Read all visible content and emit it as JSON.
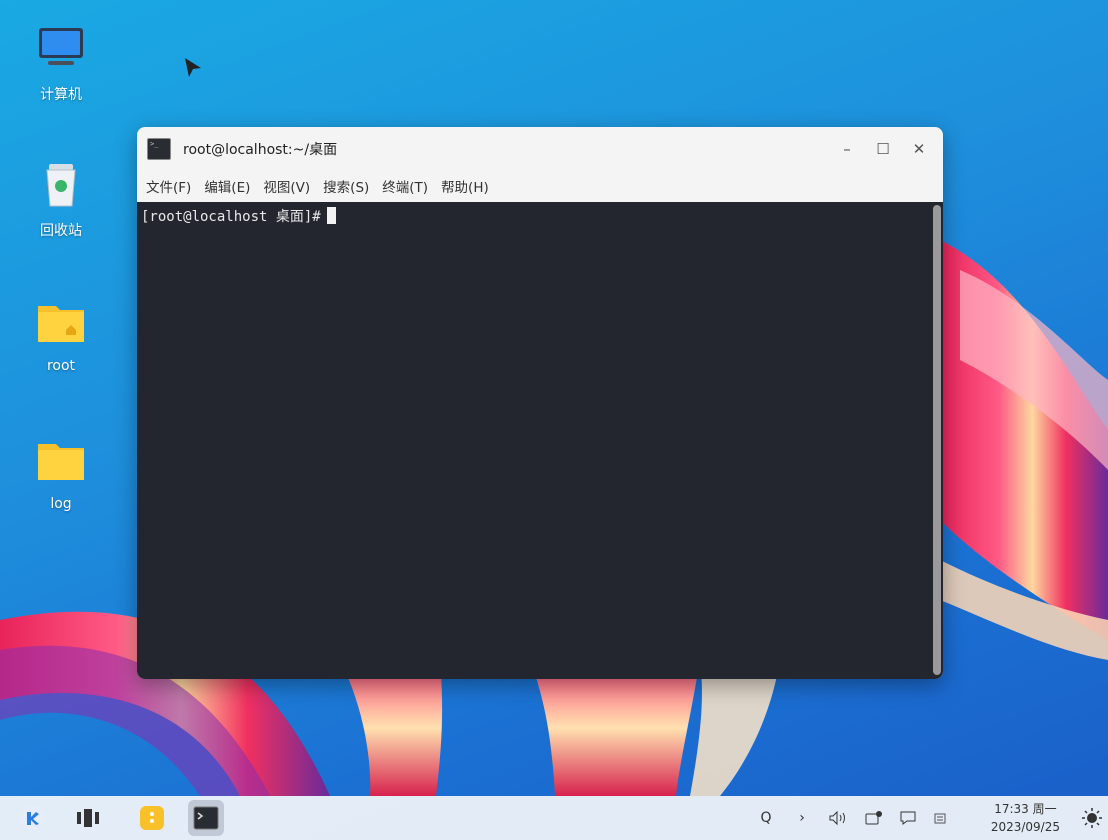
{
  "desktop": {
    "icons": [
      {
        "label": "计算机",
        "icon": "computer-icon"
      },
      {
        "label": "回收站",
        "icon": "trash-icon"
      },
      {
        "label": "root",
        "icon": "home-folder-icon"
      },
      {
        "label": "log",
        "icon": "folder-icon"
      }
    ]
  },
  "window": {
    "title": "root@localhost:~/桌面",
    "controls": {
      "minimize": "–",
      "maximize": "☐",
      "close": "✕"
    },
    "menu": [
      "文件(F)",
      "编辑(E)",
      "视图(V)",
      "搜索(S)",
      "终端(T)",
      "帮助(H)"
    ],
    "terminal": {
      "prompt": "[root@localhost 桌面]#"
    }
  },
  "taskbar": {
    "buttons": [
      "start-menu-icon",
      "multitask-view-icon",
      "file-manager-icon",
      "terminal-icon"
    ],
    "tray": [
      "search-icon",
      "expand-arrow-icon",
      "volume-icon",
      "network-icon",
      "notification-icon",
      "input-method-icon"
    ],
    "tray_glyphs": {
      "search": "Q",
      "expand": "›",
      "volume": "🔈",
      "notify": "☐"
    },
    "clock": {
      "time": "17:33 周一",
      "date": "2023/09/25"
    },
    "theme_toggle": "brightness-icon"
  },
  "colors": {
    "terminal_bg": "#23262f",
    "accent": "#1a8fe0"
  }
}
